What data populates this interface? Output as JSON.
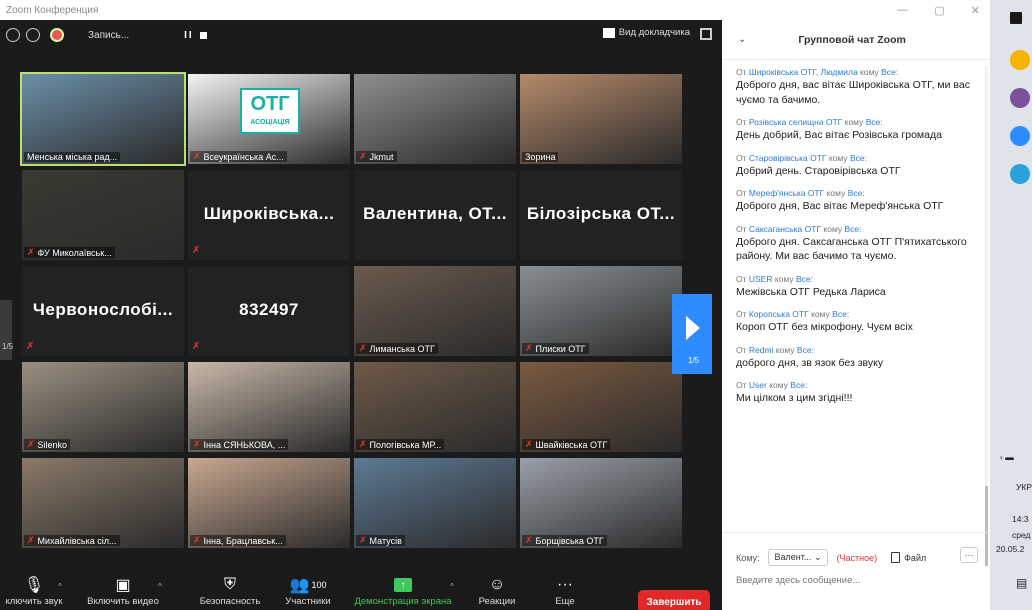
{
  "window": {
    "title": "Zoom Конференция"
  },
  "topbar": {
    "record_label": "Запись...",
    "pause_label": "II",
    "speaker_view": "Вид докладчика"
  },
  "tiles": [
    {
      "name": "Менська міська рад...",
      "kind": "video",
      "color": "#6b8fa8",
      "active": true
    },
    {
      "name": "Всеукраїнська Ас...",
      "kind": "video",
      "color": "#f4f4f4",
      "logo": "ОТГ",
      "logo_sub": "АСОЦІАЦІЯ",
      "muted": true
    },
    {
      "name": "Jkmut",
      "kind": "video",
      "color": "#8f8f8f",
      "muted": true
    },
    {
      "name": "Зорина",
      "kind": "video",
      "color": "#b58a6a"
    },
    {
      "name": "ФУ Миколаївськ...",
      "kind": "video",
      "color": "#3a3a32",
      "muted": true
    },
    {
      "name": "",
      "kind": "text",
      "big": "Широківська...",
      "muted": true
    },
    {
      "name": "",
      "kind": "text",
      "big": "Валентина, ОТ..."
    },
    {
      "name": "",
      "kind": "text",
      "big": "Білозірська ОТ..."
    },
    {
      "name": "",
      "kind": "text",
      "big": "Червонослобі...",
      "muted": true
    },
    {
      "name": "",
      "kind": "text",
      "big": "832497",
      "muted": true
    },
    {
      "name": "Лиманська ОТГ",
      "kind": "video",
      "color": "#6b5a4e",
      "muted": true
    },
    {
      "name": "Плиски ОТГ",
      "kind": "video",
      "color": "#8a8f93",
      "muted": true
    },
    {
      "name": "Silenko",
      "kind": "video",
      "color": "#9a9080",
      "muted": true
    },
    {
      "name": "Інна СЯНЬКОВА, ...",
      "kind": "video",
      "color": "#c9b8a8",
      "muted": true
    },
    {
      "name": "Пологівська МР...",
      "kind": "video",
      "color": "#6e5a48",
      "muted": true
    },
    {
      "name": "Швайківська ОТГ",
      "kind": "video",
      "color": "#7a5a40",
      "muted": true
    },
    {
      "name": "Михайлівська сіл...",
      "kind": "video",
      "color": "#8a7a68",
      "muted": true
    },
    {
      "name": "Інна, Брацлавськ...",
      "kind": "video",
      "color": "#c8a890",
      "muted": true
    },
    {
      "name": "Матусів",
      "kind": "video",
      "color": "#5d7a93",
      "muted": true
    },
    {
      "name": "Борщівська ОТГ",
      "kind": "video",
      "color": "#9aa0a8",
      "muted": true
    }
  ],
  "pager": {
    "left": "1/5",
    "right": "1/5"
  },
  "toolbar": {
    "mute": "ключить звук",
    "video": "Включить видео",
    "security": "Безопасность",
    "participants": "Участники",
    "participants_count": "100",
    "share": "Демонстрация экрана",
    "reactions": "Реакции",
    "more": "Еще",
    "end": "Завершить"
  },
  "chat": {
    "title": "Групповой чат Zoom",
    "from_word": "От",
    "to_word": "кому",
    "messages": [
      {
        "from": "Широківська ОТГ, Людмила",
        "to": "Все:",
        "text": "Доброго дня, вас вітає Широківська ОТГ, ми вас чуємо та бачимо."
      },
      {
        "from": "Розівська селищна ОТГ",
        "to": "Все:",
        "text": "День добрий, Вас вітає Розівська громада"
      },
      {
        "from": "Старовірівська ОТГ",
        "to": "Все:",
        "text": "Добрий день. Старовірівська ОТГ"
      },
      {
        "from": "Мереф'янська ОТГ",
        "to": "Все:",
        "text": "Доброго дня, Вас вітає Мереф'янська ОТГ"
      },
      {
        "from": "Саксаганська ОТГ",
        "to": "Все:",
        "text": "Доброго дня. Саксаганська ОТГ П'ятихатського району. Ми вас бачимо та чуємо."
      },
      {
        "from": "USER",
        "to": "Все:",
        "text": "Межівська ОТГ Редька Лариса"
      },
      {
        "from": "Коропська ОТГ",
        "to": "Все:",
        "text": "Короп ОТГ без мікрофону. Чуєм всіх"
      },
      {
        "from": "Redmi",
        "to": "Все:",
        "text": "доброго дня, зв язок без звуку"
      },
      {
        "from": "User",
        "to": "Все:",
        "text": "Ми цілком з цим згідні!!!"
      }
    ],
    "to_label": "Кому:",
    "to_value": "Валент...",
    "private_label": "(Частное)",
    "file_label": "Файл",
    "more_label": "···",
    "input_placeholder": "Введите здесь сообщение..."
  },
  "taskbar": {
    "lang": "УКР",
    "time": "14:3",
    "day": "сред",
    "date": "20.05.2"
  }
}
